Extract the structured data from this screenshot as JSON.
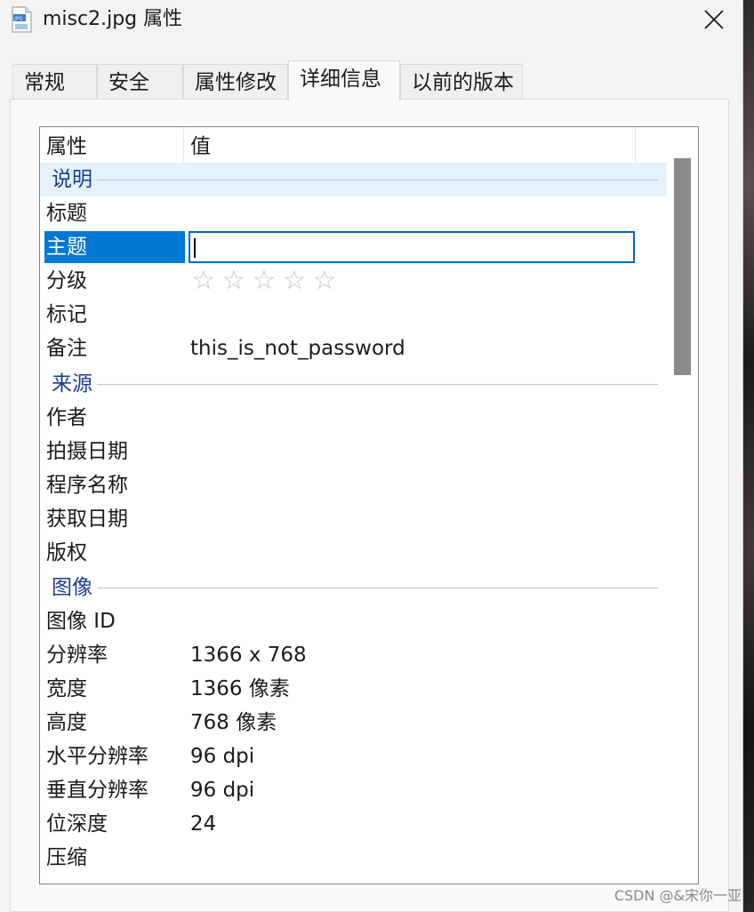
{
  "window": {
    "title": "misc2.jpg 属性",
    "file_icon_label": "JPG"
  },
  "tabs": [
    {
      "label": "常规"
    },
    {
      "label": "安全"
    },
    {
      "label": "属性修改"
    },
    {
      "label": "详细信息",
      "active": true
    },
    {
      "label": "以前的版本"
    }
  ],
  "list": {
    "header": {
      "property": "属性",
      "value": "值"
    },
    "sections": {
      "description": "说明",
      "origin": "来源",
      "image": "图像"
    },
    "rows": {
      "title": {
        "k": "标题",
        "v": ""
      },
      "subject": {
        "k": "主题",
        "v": ""
      },
      "rating": {
        "k": "分级",
        "stars": 5,
        "filled": 0
      },
      "tags": {
        "k": "标记",
        "v": ""
      },
      "comments": {
        "k": "备注",
        "v": "this_is_not_password"
      },
      "author": {
        "k": "作者",
        "v": ""
      },
      "date_taken": {
        "k": "拍摄日期",
        "v": ""
      },
      "program": {
        "k": "程序名称",
        "v": ""
      },
      "date_acquired": {
        "k": "获取日期",
        "v": ""
      },
      "copyright": {
        "k": "版权",
        "v": ""
      },
      "image_id": {
        "k": "图像 ID",
        "v": ""
      },
      "dimensions": {
        "k": "分辨率",
        "v": "1366 x 768"
      },
      "width": {
        "k": "宽度",
        "v": "1366 像素"
      },
      "height": {
        "k": "高度",
        "v": "768 像素"
      },
      "hres": {
        "k": "水平分辨率",
        "v": "96 dpi"
      },
      "vres": {
        "k": "垂直分辨率",
        "v": "96 dpi"
      },
      "bitdepth": {
        "k": "位深度",
        "v": "24"
      },
      "compression": {
        "k": "压缩",
        "v": ""
      }
    }
  },
  "colors": {
    "accent": "#0078d4",
    "section_text": "#1e3d8f"
  },
  "watermark": "CSDN @&宋你一亚"
}
